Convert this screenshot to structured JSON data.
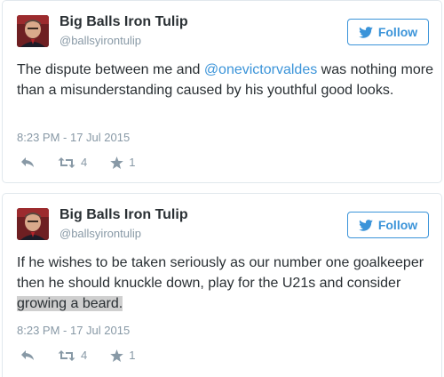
{
  "tweets": [
    {
      "display_name": "Big Balls Iron Tulip",
      "handle": "@ballsyirontulip",
      "follow_label": "Follow",
      "text_before": "The dispute between me and ",
      "mention": "@onevictorvaldes",
      "text_after": " was nothing more than a misunderstanding caused by his youthful good looks.",
      "timestamp": "8:23 PM - 17 Jul 2015",
      "retweets": "4",
      "favorites": "1"
    },
    {
      "display_name": "Big Balls Iron Tulip",
      "handle": "@ballsyirontulip",
      "follow_label": "Follow",
      "text_before": "If he wishes to be taken seriously as our number one goalkeeper then he should knuckle down, play for the U21s and consider ",
      "highlight": "growing a beard.",
      "timestamp": "8:23 PM - 17 Jul 2015",
      "retweets": "4",
      "favorites": "1"
    }
  ],
  "icons": {
    "follow": "twitter-bird-icon",
    "reply": "reply-icon",
    "retweet": "retweet-icon",
    "favorite": "star-icon"
  },
  "colors": {
    "accent": "#3b94d9",
    "text": "#292f33",
    "muted": "#8899a6",
    "border": "#e1e8ed",
    "highlight": "#cfcfcf"
  }
}
